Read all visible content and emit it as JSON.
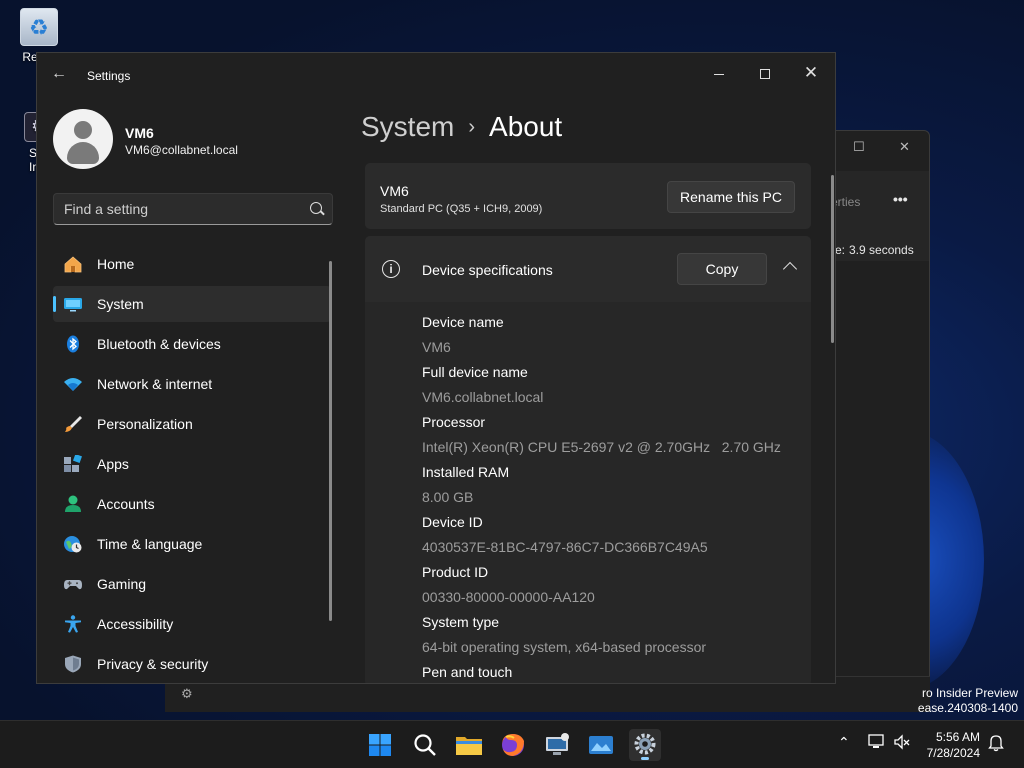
{
  "desktop": {
    "icons": [
      {
        "label": "Recyc"
      },
      {
        "label_line1": "Sys",
        "label_line2": "Info"
      }
    ],
    "watermark_line1": "ro Insider Preview",
    "watermark_line2": "ease.240308-1400"
  },
  "background_window": {
    "toolbar_partial": "erties",
    "more": "•••",
    "duration_prefix": "e:",
    "duration": "3.9 seconds"
  },
  "settings": {
    "app_title": "Settings",
    "profile": {
      "name": "VM6",
      "email": "VM6@collabnet.local"
    },
    "search": {
      "placeholder": "Find a setting"
    },
    "nav": [
      {
        "label": "Home",
        "icon": "home-icon"
      },
      {
        "label": "System",
        "icon": "system-icon",
        "active": true
      },
      {
        "label": "Bluetooth & devices",
        "icon": "bluetooth-icon"
      },
      {
        "label": "Network & internet",
        "icon": "wifi-icon"
      },
      {
        "label": "Personalization",
        "icon": "brush-icon"
      },
      {
        "label": "Apps",
        "icon": "apps-icon"
      },
      {
        "label": "Accounts",
        "icon": "account-icon"
      },
      {
        "label": "Time & language",
        "icon": "clock-globe-icon"
      },
      {
        "label": "Gaming",
        "icon": "gamepad-icon"
      },
      {
        "label": "Accessibility",
        "icon": "accessibility-icon"
      },
      {
        "label": "Privacy & security",
        "icon": "shield-icon"
      }
    ],
    "breadcrumb": {
      "parent": "System",
      "separator": "›",
      "current": "About"
    },
    "pc_card": {
      "name": "VM6",
      "model": "Standard PC (Q35 + ICH9, 2009)",
      "rename_label": "Rename this PC"
    },
    "specs": {
      "title": "Device specifications",
      "copy_label": "Copy",
      "info_glyph": "i",
      "rows": [
        {
          "label": "Device name",
          "value": "VM6"
        },
        {
          "label": "Full device name",
          "value": "VM6.collabnet.local"
        },
        {
          "label": "Processor",
          "value": "Intel(R) Xeon(R) CPU E5-2697 v2 @ 2.70GHz   2.70 GHz"
        },
        {
          "label": "Installed RAM",
          "value": "8.00 GB"
        },
        {
          "label": "Device ID",
          "value": "4030537E-81BC-4797-86C7-DC366B7C49A5"
        },
        {
          "label": "Product ID",
          "value": "00330-80000-00000-AA120"
        },
        {
          "label": "System type",
          "value": "64-bit operating system, x64-based processor"
        },
        {
          "label": "Pen and touch",
          "value": ""
        }
      ]
    }
  },
  "taskbar": {
    "time": "5:56 AM",
    "date": "7/28/2024",
    "colors": {
      "start": "#1e90ff",
      "folder": "#f4c542",
      "firefox": "#ff6a2b",
      "accent": "#4cc2ff"
    }
  }
}
